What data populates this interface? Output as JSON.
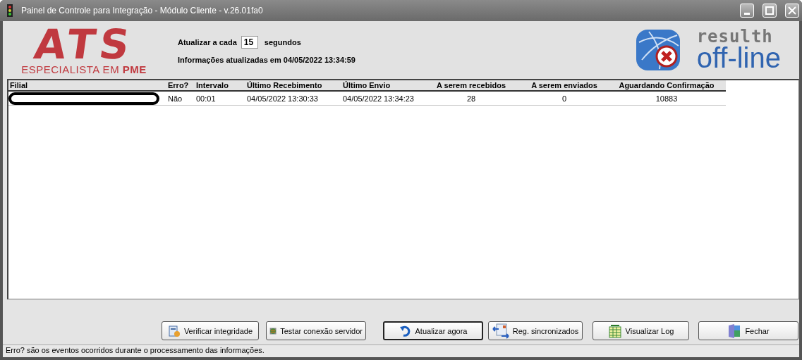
{
  "window": {
    "title": "Painel de Controle para Integração - Módulo Cliente - v.26.01fa0"
  },
  "logo": {
    "letters": "ATS",
    "tagline": "ESPECIALISTA EM **PME**"
  },
  "refresh": {
    "label": "Atualizar a cada",
    "value": "15",
    "unit": "segundos"
  },
  "last_update": "Informações atualizadas em 04/05/2022 13:34:59",
  "connection": {
    "brand": "resulth",
    "status": "off-line"
  },
  "table": {
    "columns": [
      "Filial",
      "Erro?",
      "Intervalo",
      "Último Recebimento",
      "Último Envio",
      "A serem recebidos",
      "A serem enviados",
      "Aguardando Confirmação"
    ],
    "rows": [
      {
        "filial_redacted": true,
        "cells": [
          "",
          "Não",
          "00:01",
          "04/05/2022 13:30:33",
          "04/05/2022 13:34:23",
          "28",
          "0",
          "10883"
        ]
      }
    ]
  },
  "buttons": [
    {
      "label": "Verificar integridade",
      "kind": "check",
      "default": false
    },
    {
      "label": "Testar conexão servidor",
      "kind": "connect",
      "default": false
    },
    {
      "label": "Atualizar agora",
      "kind": "refresh",
      "default": true
    },
    {
      "label": "Reg. sincronizados",
      "kind": "sync",
      "default": false
    },
    {
      "label": "Visualizar Log",
      "kind": "log",
      "default": false
    },
    {
      "label": "Fechar",
      "kind": "close",
      "default": false
    }
  ],
  "status_bar": "Erro? são os eventos ocorridos durante o processamento das informações."
}
